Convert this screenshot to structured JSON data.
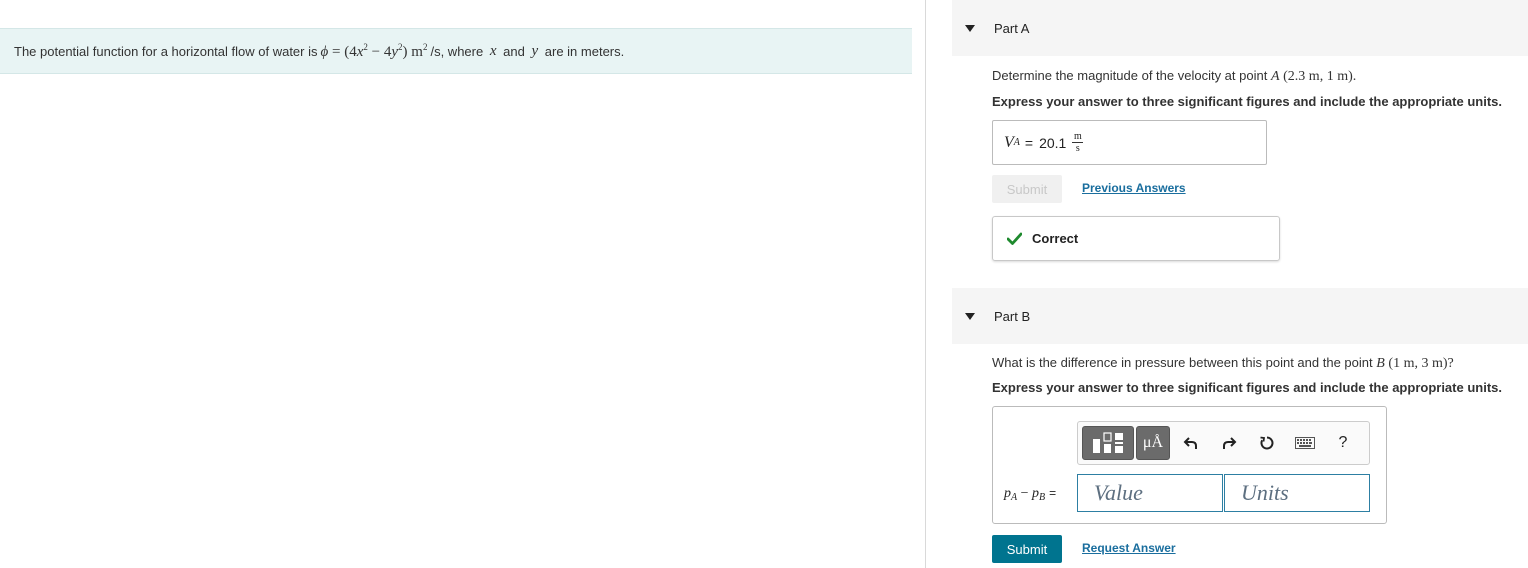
{
  "intro": {
    "prefix": "The potential function for a horizontal flow of water is",
    "phi": "ϕ",
    "eq": "=",
    "expr_open": "(4",
    "x": "x",
    "exp2a": "2",
    "minus": " − 4",
    "y": "y",
    "exp2b": "2",
    "expr_close": ")",
    "unit_m": "m",
    "exp2c": "2",
    "unit_rest": "/s, where",
    "var_x": "x",
    "and": "and",
    "var_y": "y",
    "suffix": "are in meters."
  },
  "partA": {
    "title": "Part A",
    "question_prefix": "Determine the magnitude of the velocity at point",
    "point": "A",
    "coords": "(2.3 m, 1 m).",
    "instruction": "Express your answer to three significant figures and include the appropriate units.",
    "answer_var": "V",
    "answer_sub": "A",
    "answer_eq": "=",
    "answer_value": "20.1",
    "unit_num": "m",
    "unit_den": "s",
    "submit_label": "Submit",
    "previous_answers_label": "Previous Answers",
    "feedback_label": "Correct"
  },
  "partB": {
    "title": "Part B",
    "question_prefix": "What is the difference in pressure between this point and the point",
    "point": "B",
    "coords": "(1 m, 3 m)?",
    "instruction": "Express your answer to three significant figures and include the appropriate units.",
    "label_p1": "p",
    "label_s1": "A",
    "label_minus": " − ",
    "label_p2": "p",
    "label_s2": "B",
    "label_eq": "=",
    "value_placeholder": "Value",
    "units_placeholder": "Units",
    "toolbar": {
      "mu_label": "μÅ",
      "help_label": "?"
    },
    "submit_label": "Submit",
    "request_answer_label": "Request Answer"
  },
  "colors": {
    "intro_bg": "#e8f4f4",
    "accent": "#00748f",
    "link": "#1a6e9e",
    "correct": "#1e8a2e"
  }
}
